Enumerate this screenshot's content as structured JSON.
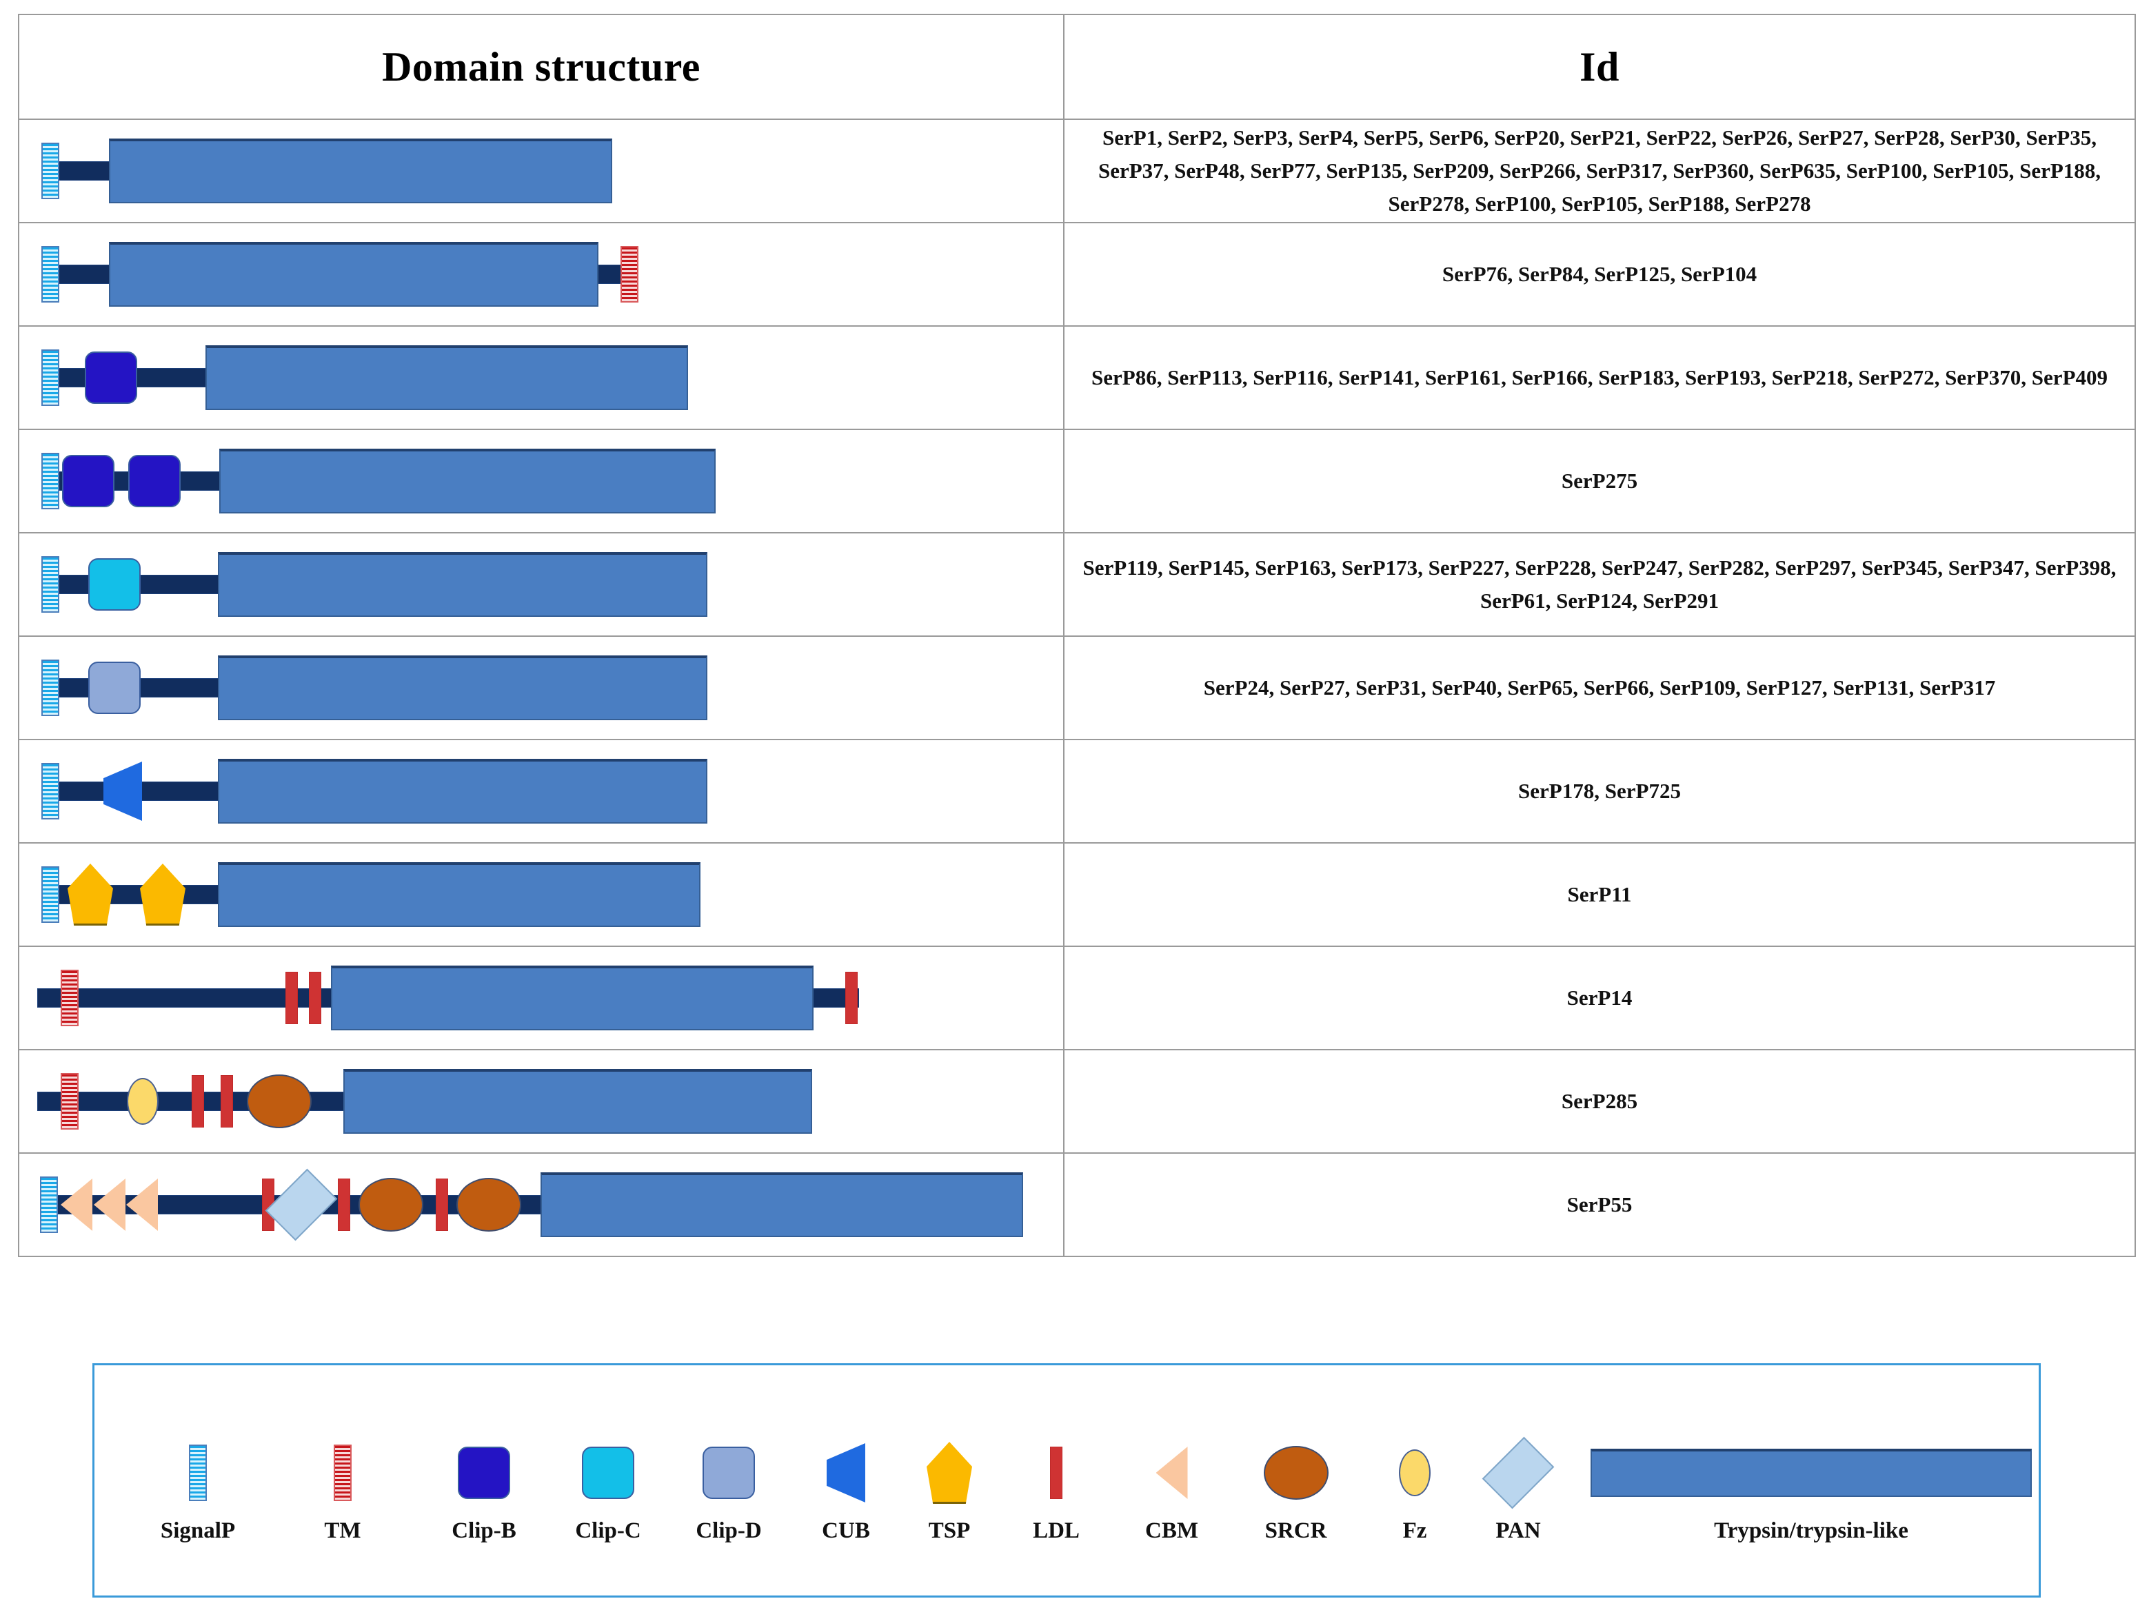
{
  "table": {
    "headers": {
      "domain_structure": "Domain structure",
      "id": "Id"
    },
    "rows": [
      {
        "ids": "SerP1, SerP2, SerP3, SerP4, SerP5, SerP6, SerP20, SerP21, SerP22, SerP26, SerP27, SerP28, SerP30,  SerP35,  SerP37,  SerP48,  SerP77,  SerP135,  SerP209,  SerP266,  SerP317,  SerP360, SerP635, SerP100, SerP105, SerP188, SerP278, SerP100, SerP105, SerP188, SerP278",
        "architecture": "SignalP - Trypsin/trypsin-like"
      },
      {
        "ids": "SerP76, SerP84, SerP125, SerP104",
        "architecture": "SignalP - Trypsin/trypsin-like - TM"
      },
      {
        "ids": "SerP86, SerP113, SerP116, SerP141, SerP161, SerP166, SerP183, SerP193, SerP218, SerP272, SerP370, SerP409",
        "architecture": "SignalP - Clip-B - Trypsin/trypsin-like"
      },
      {
        "ids": "SerP275",
        "architecture": "SignalP - Clip-B - Clip-B - Trypsin/trypsin-like"
      },
      {
        "ids": "SerP119, SerP145, SerP163, SerP173, SerP227, SerP228, SerP247, SerP282, SerP297, SerP345, SerP347, SerP398, SerP61, SerP124, SerP291",
        "architecture": "SignalP - Clip-C - Trypsin/trypsin-like"
      },
      {
        "ids": "SerP24, SerP27, SerP31, SerP40, SerP65, SerP66, SerP109, SerP127, SerP131, SerP317",
        "architecture": "SignalP - Clip-D - Trypsin/trypsin-like"
      },
      {
        "ids": "SerP178, SerP725",
        "architecture": "SignalP - CUB - Trypsin/trypsin-like"
      },
      {
        "ids": "SerP11",
        "architecture": "SignalP - TSP - TSP - Trypsin/trypsin-like"
      },
      {
        "ids": "SerP14",
        "architecture": "TM - LDL - LDL - Trypsin/trypsin-like - LDL"
      },
      {
        "ids": "SerP285",
        "architecture": "TM - Fz - LDL - LDL - SRCR - Trypsin/trypsin-like"
      },
      {
        "ids": "SerP55",
        "architecture": "SignalP - CBM - CBM - CBM - LDL - PAN - LDL - SRCR - LDL - SRCR - Trypsin/trypsin-like"
      }
    ]
  },
  "legend": {
    "items": [
      {
        "label": "SignalP",
        "glyph": "signalp-striped-bar"
      },
      {
        "label": "TM",
        "glyph": "tm-striped-bar"
      },
      {
        "label": "Clip-B",
        "glyph": "clip-b-rounded-square"
      },
      {
        "label": "Clip-C",
        "glyph": "clip-c-rounded-square"
      },
      {
        "label": "Clip-D",
        "glyph": "clip-d-rounded-square"
      },
      {
        "label": "CUB",
        "glyph": "cub-trapezoid"
      },
      {
        "label": "TSP",
        "glyph": "tsp-pentagon"
      },
      {
        "label": "LDL",
        "glyph": "ldl-bar"
      },
      {
        "label": "CBM",
        "glyph": "cbm-triangle"
      },
      {
        "label": "SRCR",
        "glyph": "srcr-ellipse"
      },
      {
        "label": "Fz",
        "glyph": "fz-ellipse"
      },
      {
        "label": "PAN",
        "glyph": "pan-diamond"
      },
      {
        "label": "Trypsin/trypsin-like",
        "glyph": "trypsin-rectangle"
      }
    ]
  },
  "colors": {
    "signalp": "#19a8e8",
    "tm": "#c7161b",
    "clip_b": "#2414c4",
    "clip_c": "#13bfe8",
    "clip_d": "#8fa9d8",
    "cub": "#1f6ae0",
    "tsp": "#fbb900",
    "ldl": "#cf3333",
    "cbm": "#fac7a0",
    "srcr": "#c05c10",
    "fz": "#fbd96a",
    "pan": "#bad6ee",
    "trypsin": "#4a7ec2",
    "backbone": "#112d5e",
    "legend_border": "#3a9ad9",
    "table_border": "#9a9a9a"
  }
}
